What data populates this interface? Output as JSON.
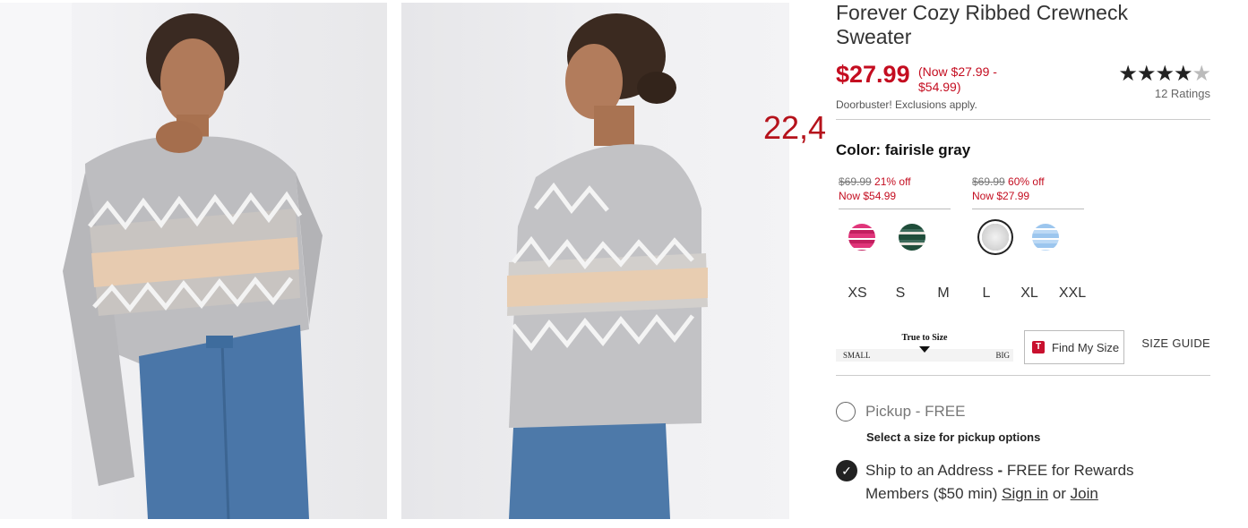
{
  "images": [
    {
      "label": "Model front view wearing fairisle gray sweater"
    },
    {
      "label": "Model back view wearing fairisle gray sweater"
    }
  ],
  "overlay_number": "22,4",
  "product": {
    "title": "Forever Cozy Ribbed Crewneck Sweater",
    "price": "$27.99",
    "price_range": "(Now $27.99 - $54.99)",
    "rating_stars": "★★★★★",
    "rating_value": 4.5,
    "ratings_count": "12 Ratings",
    "doorbuster": "Doorbuster! Exclusions apply."
  },
  "color": {
    "label": "Color: fairisle gray",
    "groups": [
      {
        "old": "$69.99",
        "discount": "21% off",
        "now": "Now $54.99"
      },
      {
        "old": "$69.99",
        "discount": "60% off",
        "now": "Now $27.99"
      }
    ],
    "swatches": [
      {
        "name": "pink-stripe",
        "colors": [
          "#e0357a",
          "#ffffff"
        ]
      },
      {
        "name": "green-stripe",
        "colors": [
          "#1f4d3a",
          "#e6e2da"
        ]
      },
      {
        "name": "fairisle-gray",
        "colors": [
          "#cfcfcf",
          "#f2f2f2"
        ],
        "selected": true
      },
      {
        "name": "blue-stripe",
        "colors": [
          "#9cc6ee",
          "#ffffff"
        ]
      }
    ]
  },
  "sizes": [
    "XS",
    "S",
    "M",
    "L",
    "XL",
    "XXL"
  ],
  "fit": {
    "label": "True to Size",
    "small": "SMALL",
    "big": "BIG"
  },
  "find_my_size": {
    "icon": "T",
    "label": "Find My Size"
  },
  "size_guide": "SIZE GUIDE",
  "fulfillment": {
    "pickup": "Pickup - FREE",
    "pickup_hint": "Select a size for pickup options",
    "ship_prefix": "Ship to an Address",
    "ship_dash": " - ",
    "ship_free": "FREE for Rewards Members ($50 min) ",
    "sign_in": "Sign in",
    "or": " or ",
    "join": "Join"
  },
  "colors": {
    "sale_red": "#c40d20",
    "overlay_red": "#b5121b"
  }
}
